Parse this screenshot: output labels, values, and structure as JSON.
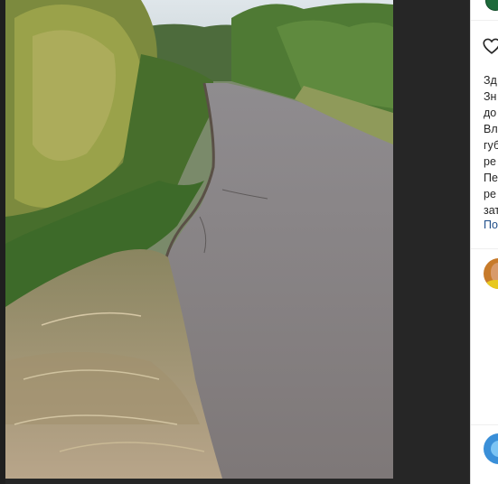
{
  "post": {
    "image_alt": "",
    "caption_lines": [
      "Зд",
      "Зн",
      "до",
      "Вл",
      "губ",
      "ре",
      "Пе",
      "ре",
      "зат"
    ],
    "more_link": "По"
  },
  "icons": {
    "like": "heart-icon",
    "author_avatar": "avatar",
    "comment_avatar": "avatar",
    "bottom_avatar": "avatar"
  },
  "colors": {
    "backdrop": "#262626",
    "panel_bg": "#ffffff",
    "text": "#262626",
    "link": "#1f4e8a",
    "author_ring": "#1d6a3a"
  }
}
